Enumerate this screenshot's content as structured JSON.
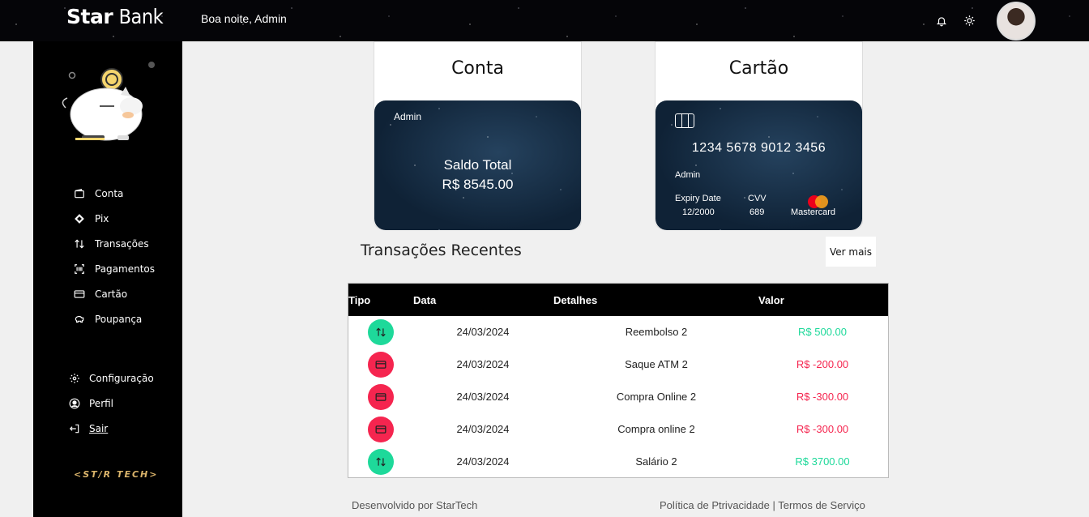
{
  "header": {
    "brand_bold": "Star",
    "brand_light": "Bank",
    "greeting": "Boa noite, Admin"
  },
  "sidebar": {
    "items": [
      {
        "label": "Conta",
        "icon": "wallet-icon"
      },
      {
        "label": "Pix",
        "icon": "pix-icon"
      },
      {
        "label": "Transações",
        "icon": "arrows-updown-icon"
      },
      {
        "label": "Pagamentos",
        "icon": "barcode-scan-icon"
      },
      {
        "label": "Cartão",
        "icon": "credit-card-icon"
      },
      {
        "label": "Poupança",
        "icon": "piggy-bank-icon"
      }
    ],
    "bottom_items": [
      {
        "label": "Configuração",
        "icon": "gear-icon"
      },
      {
        "label": "Perfil",
        "icon": "user-circle-icon"
      },
      {
        "label": "Sair",
        "icon": "logout-icon"
      }
    ],
    "footer_logo": "<ST∕R TECH>"
  },
  "account_panel": {
    "title": "Conta",
    "holder": "Admin",
    "balance_label": "Saldo Total",
    "balance_value": "R$ 8545.00"
  },
  "card_panel": {
    "title": "Cartão",
    "number": "1234 5678 9012 3456",
    "holder": "Admin",
    "expiry_label": "Expiry Date",
    "expiry_value": "12/2000",
    "cvv_label": "CVV",
    "cvv_value": "689",
    "brand": "Mastercard"
  },
  "transactions": {
    "title": "Transações Recentes",
    "more_button": "Ver mais",
    "columns": [
      "Tipo",
      "Data",
      "Detalhes",
      "Valor"
    ],
    "rows": [
      {
        "type": "transfer",
        "date": "24/03/2024",
        "details": "Reembolso 2",
        "value": "R$ 500.00"
      },
      {
        "type": "card",
        "date": "24/03/2024",
        "details": "Saque ATM 2",
        "value": "R$ -200.00"
      },
      {
        "type": "card",
        "date": "24/03/2024",
        "details": "Compra Online 2",
        "value": "R$ -300.00"
      },
      {
        "type": "card",
        "date": "24/03/2024",
        "details": "Compra online 2",
        "value": "R$ -300.00"
      },
      {
        "type": "transfer",
        "date": "24/03/2024",
        "details": "Salário 2",
        "value": "R$ 3700.00"
      }
    ]
  },
  "footer": {
    "left": "Desenvolvido por StarTech",
    "right": "Política de Ptrivacidade | Termos de Serviço"
  },
  "colors": {
    "positive": "#1ed99a",
    "negative": "#f5254f",
    "sidebar_bg": "#000000",
    "page_bg": "#f0f0f0"
  }
}
